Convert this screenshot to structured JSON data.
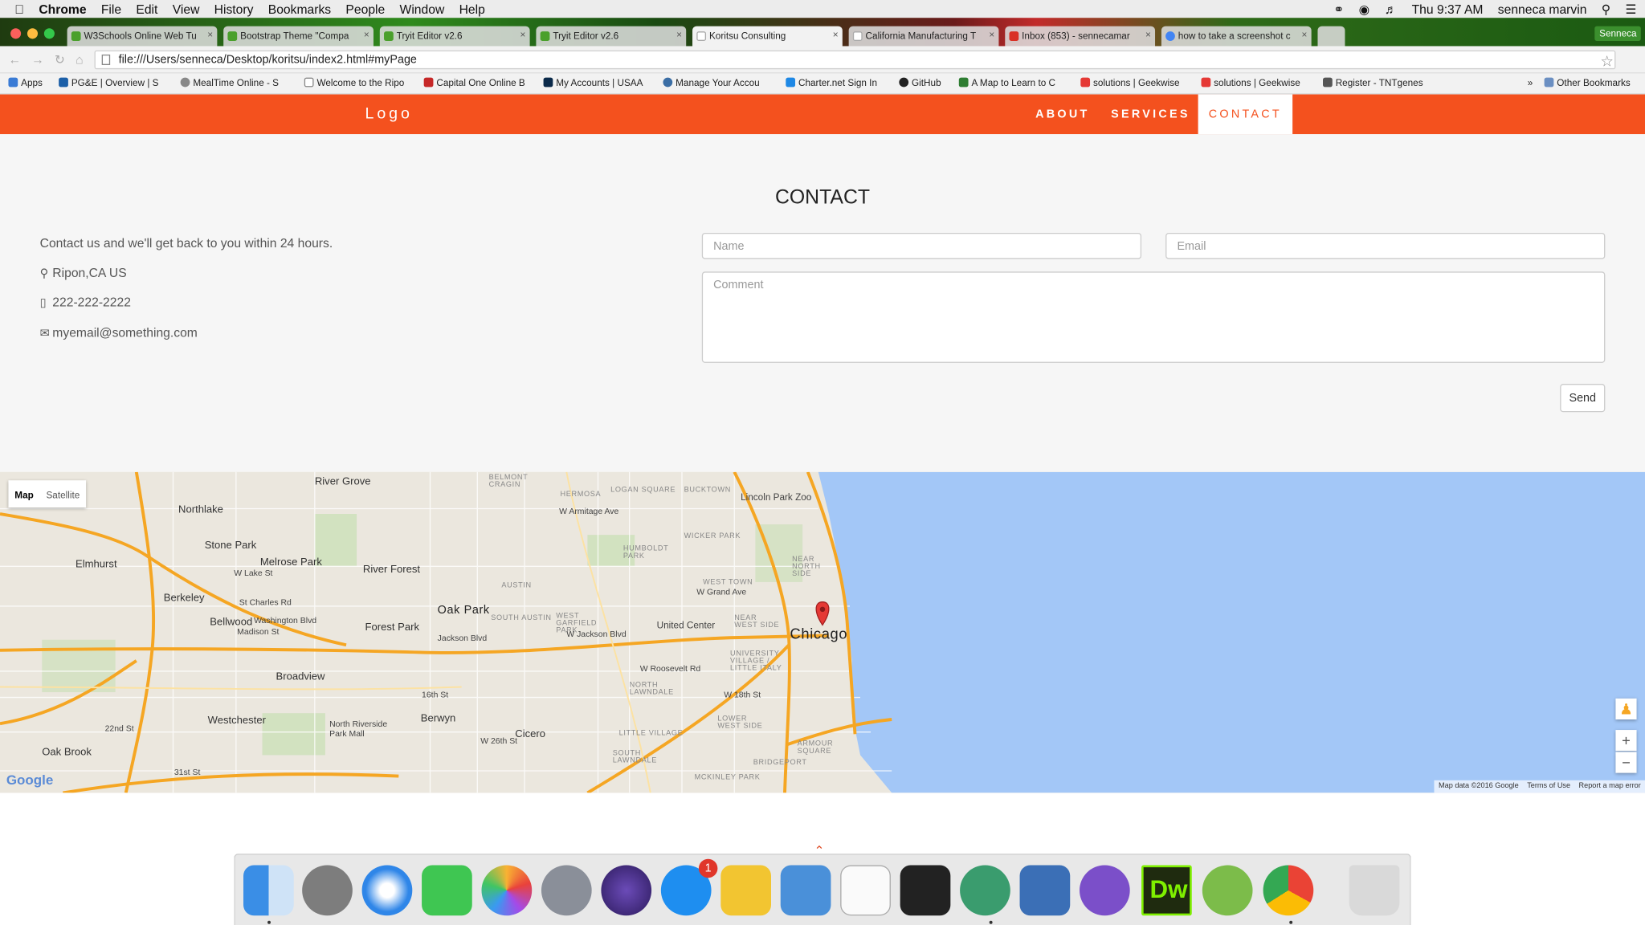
{
  "menubar": {
    "app": "Chrome",
    "items": [
      "File",
      "Edit",
      "View",
      "History",
      "Bookmarks",
      "People",
      "Window",
      "Help"
    ],
    "clock": "Thu 9:37 AM",
    "user": "senneca marvin"
  },
  "tabs": [
    "W3Schools Online Web Tu",
    "Bootstrap Theme \"Compa",
    "Tryit Editor v2.6",
    "Tryit Editor v2.6",
    "Koritsu Consulting",
    "California Manufacturing T",
    "Inbox (853) - sennecamar",
    "how to take a screenshot c"
  ],
  "profile_button": "Senneca",
  "address_bar": {
    "url": "file:///Users/senneca/Desktop/koritsu/index2.html#myPage"
  },
  "bookmarks": [
    "Apps",
    "PG&E | Overview | S",
    "MealTime Online - S",
    "Welcome to the Ripo",
    "Capital One Online B",
    "My Accounts | USAA",
    "Manage Your Accou",
    "Charter.net Sign In",
    "GitHub",
    "A Map to Learn to C",
    "solutions | Geekwise",
    "solutions | Geekwise",
    "Register - TNTgenes"
  ],
  "other_bookmarks": "Other Bookmarks",
  "navbar": {
    "logo": "Logo",
    "links": {
      "about": "ABOUT",
      "services": "SERVICES",
      "contact": "CONTACT"
    }
  },
  "contact": {
    "title": "CONTACT",
    "intro": "Contact us and we'll get back to you within 24 hours.",
    "location": "Ripon,CA US",
    "phone": "222-222-2222",
    "email": "myemail@something.com",
    "name_placeholder": "Name",
    "email_placeholder": "Email",
    "comment_placeholder": "Comment",
    "send_label": "Send"
  },
  "map": {
    "type_map": "Map",
    "type_satellite": "Satellite",
    "city_label": "Chicago",
    "labels": [
      "River Grove",
      "Northlake",
      "Stone Park",
      "Melrose Park",
      "River Forest",
      "Elmhurst",
      "Berkeley",
      "Bellwood",
      "Oak Park",
      "Forest Park",
      "Broadview",
      "Westchester",
      "Berwyn",
      "Cicero",
      "Oak Brook",
      "North Riverside Park Mall",
      "United Center",
      "Lincoln Park Zoo"
    ],
    "areas": [
      "BELMONT CRAGIN",
      "HERMOSA",
      "LOGAN SQUARE",
      "BUCKTOWN",
      "HUMBOLDT PARK",
      "WICKER PARK",
      "AUSTIN",
      "WEST TOWN",
      "NEAR NORTH SIDE",
      "SOUTH AUSTIN",
      "WEST GARFIELD PARK",
      "NEAR WEST SIDE",
      "UNIVERSITY VILLAGE / LITTLE ITALY",
      "NORTH LAWNDALE",
      "LOWER WEST SIDE",
      "LITTLE VILLAGE",
      "SOUTH LAWNDALE",
      "ARMOUR SQUARE",
      "BRIDGEPORT",
      "MCKINLEY PARK"
    ],
    "streets": [
      "W Armitage Ave",
      "W Grand Ave",
      "W Jackson Blvd",
      "W Roosevelt Rd",
      "W 18th St",
      "16th St",
      "W 26th St",
      "W Lake St",
      "St Charles Rd",
      "Washington Blvd",
      "Madison St",
      "Jackson Blvd",
      "22nd St",
      "31st St"
    ],
    "footer": [
      "Map data ©2016 Google",
      "Terms of Use",
      "Report a map error"
    ],
    "google": "Google",
    "zoom_in": "+",
    "zoom_out": "−"
  },
  "dock": {
    "apps": [
      "finder-icon",
      "system-preferences-icon",
      "safari-icon",
      "facetime-icon",
      "photos-icon",
      "launchpad-icon",
      "eclipse-icon",
      "app-store-icon",
      "cyberduck-icon",
      "xcode-icon",
      "typora-icon",
      "unity-icon",
      "atom-icon",
      "virtualbox-icon",
      "github-desktop-icon",
      "dreamweaver-icon",
      "android-studio-icon",
      "chrome-icon",
      "trash-icon"
    ],
    "app_store_badge": "1",
    "dreamweaver_label": "Dw"
  },
  "colors": {
    "brand": "#f4511e",
    "water": "#a3c7f7",
    "highway": "#f5a623"
  }
}
